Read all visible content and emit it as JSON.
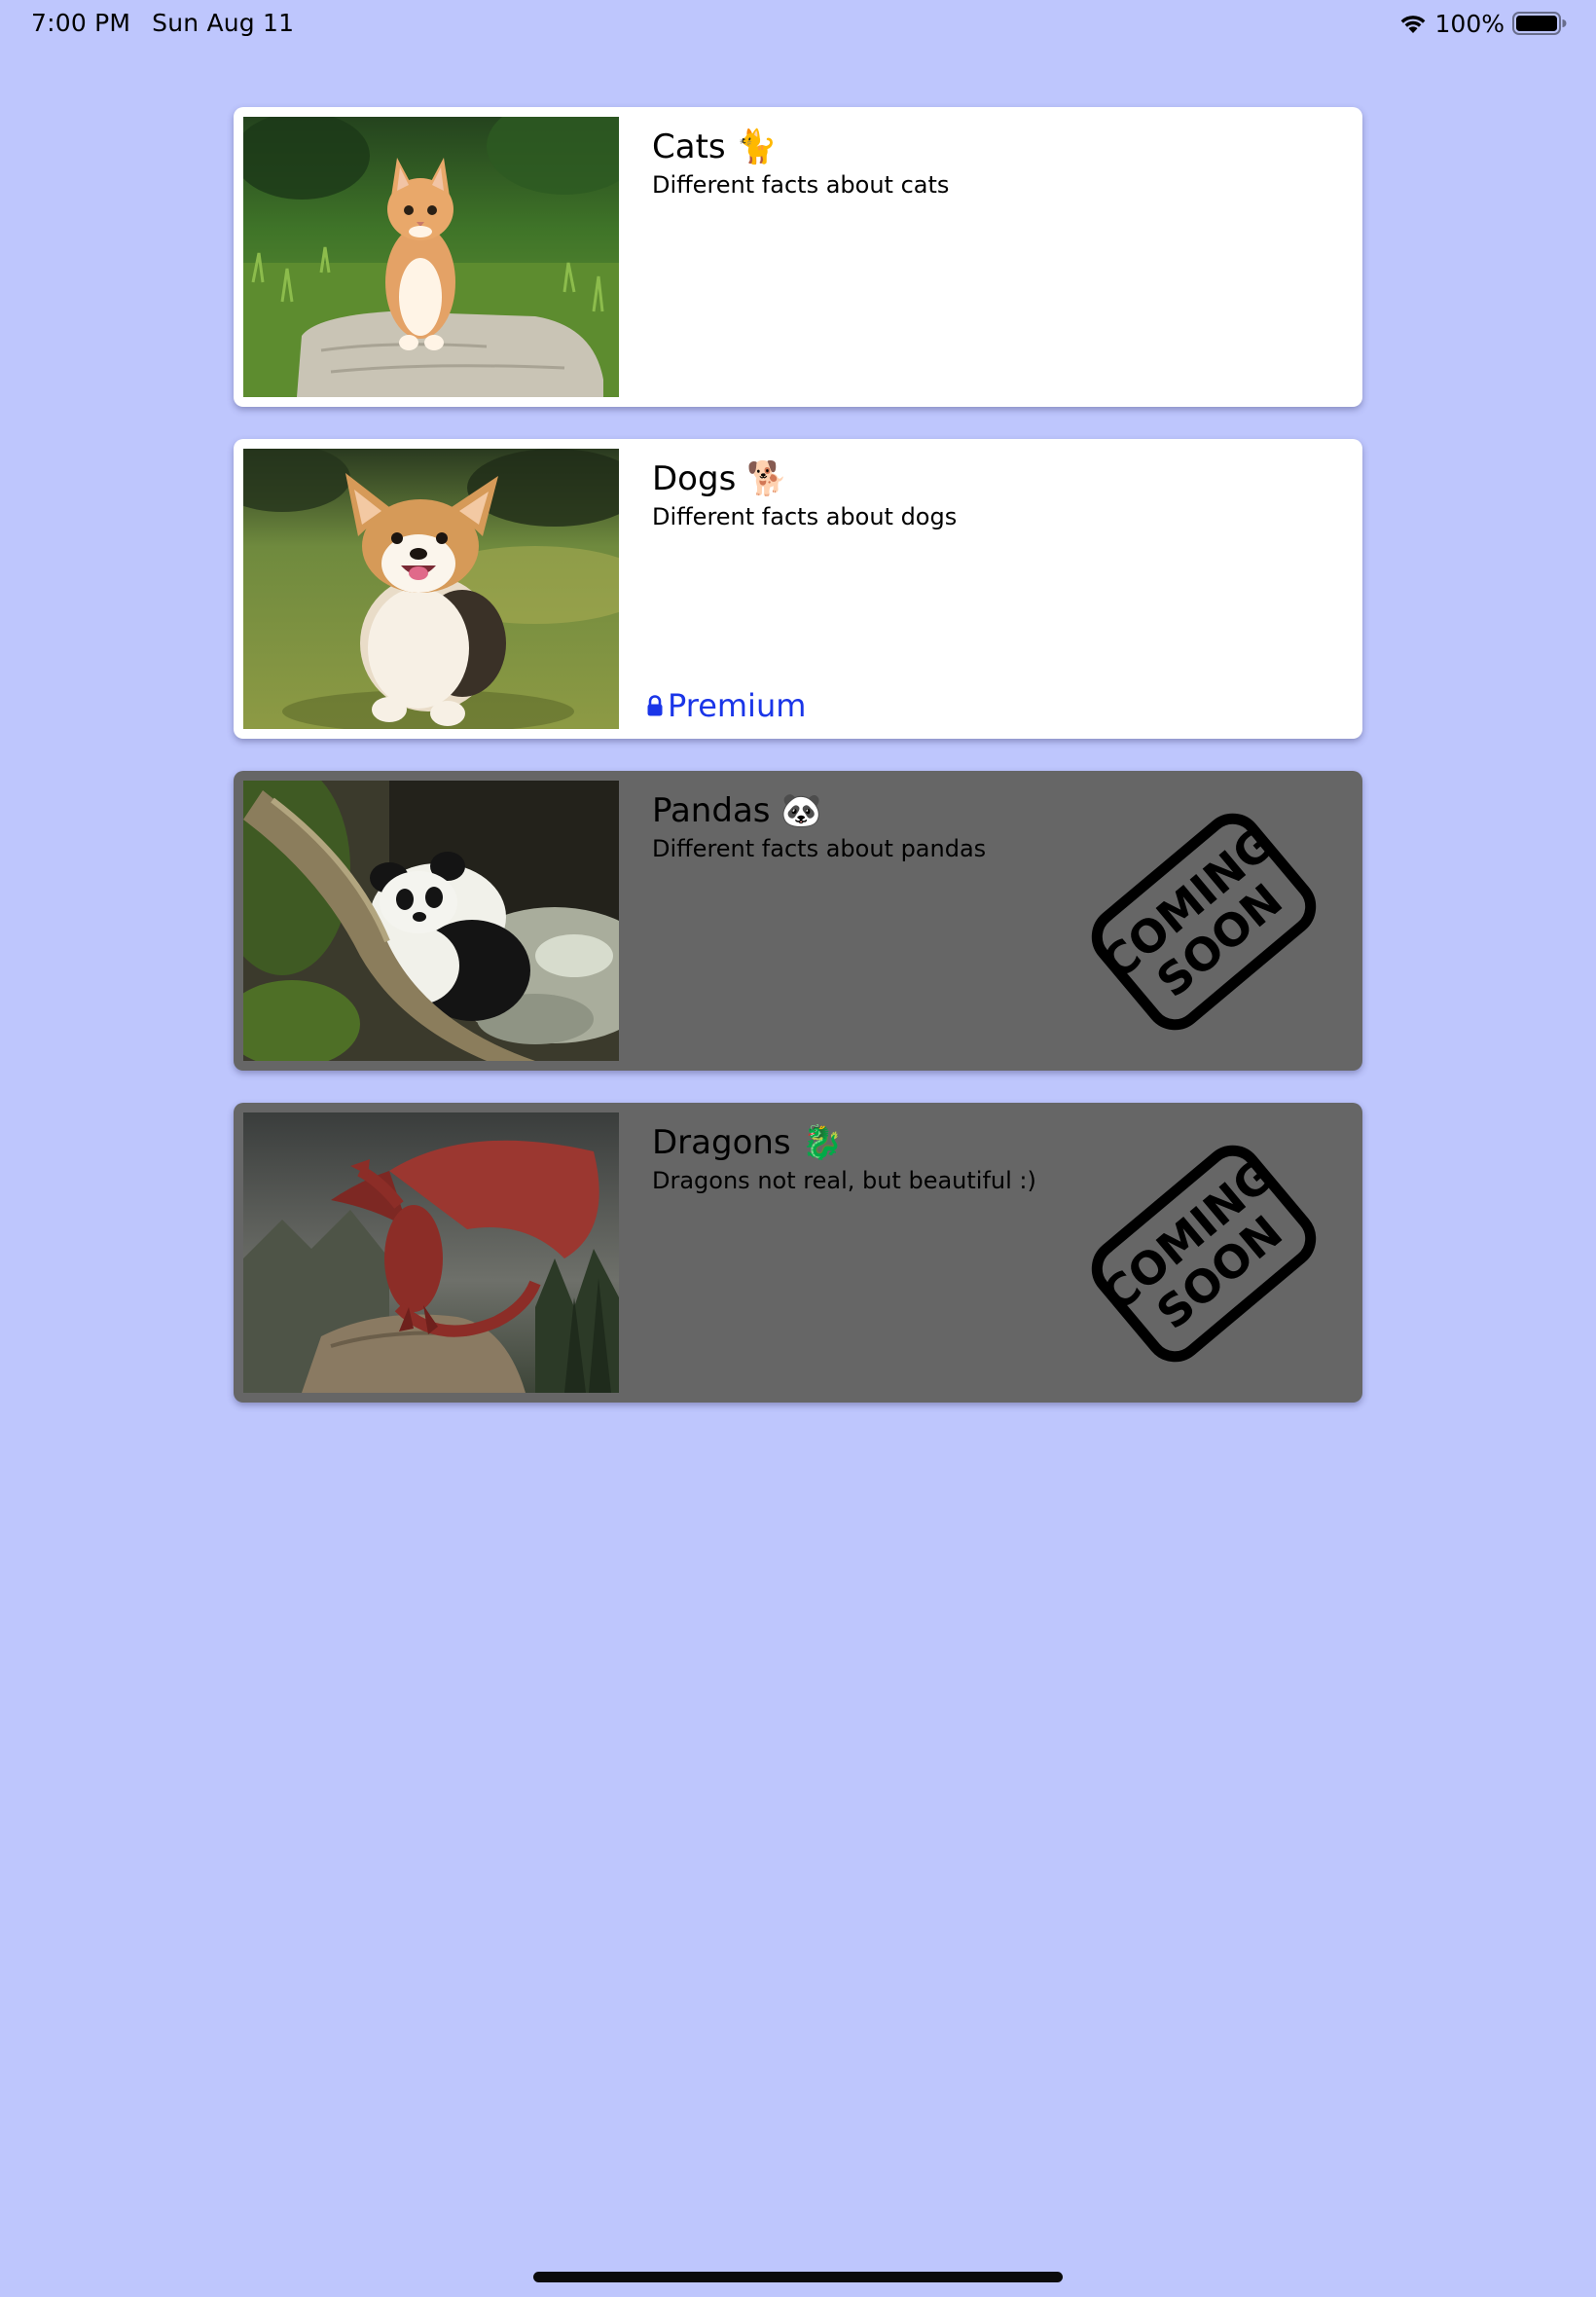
{
  "status_bar": {
    "time": "7:00 PM",
    "date": "Sun Aug 11",
    "battery": "100%"
  },
  "cards": [
    {
      "title": "Cats 🐈",
      "subtitle": "Different facts about cats",
      "image": "kitten-photo",
      "state": "available"
    },
    {
      "title": "Dogs 🐕",
      "subtitle": "Different facts about dogs",
      "image": "corgi-photo",
      "state": "locked",
      "badge": "Premium"
    },
    {
      "title": "Pandas 🐼",
      "subtitle": "Different facts about pandas",
      "image": "panda-photo",
      "state": "coming-soon",
      "stamp": [
        "COMING",
        "SOON"
      ]
    },
    {
      "title": "Dragons 🐉",
      "subtitle": "Dragons not real, but beautiful :)",
      "image": "dragon-artwork",
      "state": "coming-soon",
      "stamp": [
        "COMING",
        "SOON"
      ]
    }
  ],
  "colors": {
    "background": "#bec6fd",
    "card": "#ffffff",
    "card_disabled": "#666666",
    "premium": "#1a35e8"
  },
  "icons": [
    "wifi-icon",
    "battery-icon",
    "lock-icon",
    "coming-soon-stamp"
  ]
}
